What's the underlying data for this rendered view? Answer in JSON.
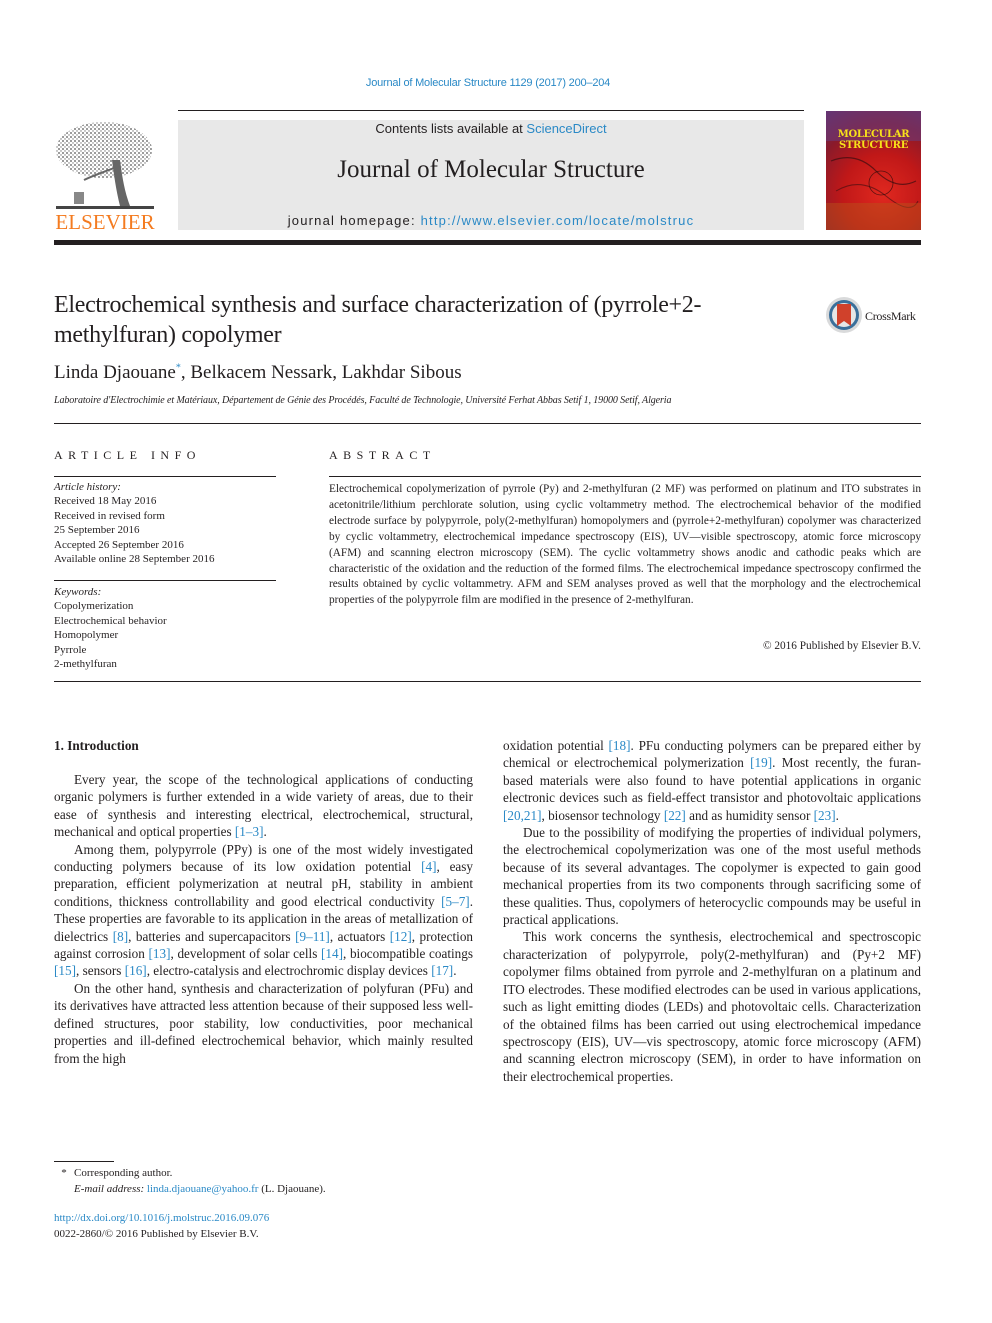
{
  "header": {
    "citation": "Journal of Molecular Structure 1129 (2017) 200–204",
    "contents_prefix": "Contents lists available at ",
    "contents_link": "ScienceDirect",
    "journal_name": "Journal of Molecular Structure",
    "homepage_prefix": "journal homepage: ",
    "homepage_url": "http://www.elsevier.com/locate/molstruc",
    "publisher_logo_text": "ELSEVIER",
    "cover_title_line1": "MOLECULAR",
    "cover_title_line2": "STRUCTURE",
    "colors": {
      "link": "#2a89c6",
      "elsevier_orange": "#f47b20",
      "grey_box": "#e8e8e8",
      "cover_yellow": "#f7e11a"
    }
  },
  "article": {
    "title": "Electrochemical synthesis and surface characterization of (pyrrole+2-methylfuran) copolymer",
    "crossmark_label": "CrossMark",
    "authors": [
      {
        "name": "Linda Djaouane",
        "mark": "*"
      },
      {
        "name": "Belkacem Nessark",
        "mark": ""
      },
      {
        "name": "Lakhdar Sibous",
        "mark": ""
      }
    ],
    "author_sep": ", ",
    "affiliation": "Laboratoire d'Electrochimie et Matériaux, Département de Génie des Procédés, Faculté de Technologie, Université Ferhat Abbas Setif 1, 19000 Setif, Algeria"
  },
  "article_info": {
    "heading": "ARTICLE INFO",
    "history_label": "Article history:",
    "history": [
      "Received 18 May 2016",
      "Received in revised form",
      "25 September 2016",
      "Accepted 26 September 2016",
      "Available online 28 September 2016"
    ],
    "keywords_label": "Keywords:",
    "keywords": [
      "Copolymerization",
      "Electrochemical behavior",
      "Homopolymer",
      "Pyrrole",
      "2-methylfuran"
    ]
  },
  "abstract": {
    "heading": "ABSTRACT",
    "text": "Electrochemical copolymerization of pyrrole (Py) and 2-methylfuran (2 MF) was performed on platinum and ITO substrates in acetonitrile/lithium perchlorate solution, using cyclic voltammetry method. The electrochemical behavior of the modified electrode surface by polypyrrole, poly(2-methylfuran) homopolymers and (pyrrole+2-methylfuran) copolymer was characterized by cyclic voltammetry, electrochemical impedance spectroscopy (EIS), UV—visible spectroscopy, atomic force microscopy (AFM) and scanning electron microscopy (SEM). The cyclic voltammetry shows anodic and cathodic peaks which are characteristic of the oxidation and the reduction of the formed films. The electrochemical impedance spectroscopy confirmed the results obtained by cyclic voltammetry. AFM and SEM analyses proved as well that the morphology and the electrochemical properties of the polypyrrole film are modified in the presence of 2-methylfuran.",
    "copyright": "© 2016 Published by Elsevier B.V."
  },
  "body": {
    "section_heading": "1.  Introduction",
    "left_paragraphs": [
      [
        {
          "t": "Every year, the scope of the technological applications of conducting organic polymers is further extended in a wide variety of areas, due to their ease of synthesis and interesting electrical, electrochemical, structural, mechanical and optical properties "
        },
        {
          "ref": "[1–3]"
        },
        {
          "t": "."
        }
      ],
      [
        {
          "t": "Among them, polypyrrole (PPy) is one of the most widely investigated conducting polymers because of its low oxidation potential "
        },
        {
          "ref": "[4]"
        },
        {
          "t": ", easy preparation, efficient polymerization at neutral pH, stability in ambient conditions, thickness controllability and good electrical conductivity "
        },
        {
          "ref": "[5–7]"
        },
        {
          "t": ". These properties are favorable to its application in the areas of metallization of dielectrics "
        },
        {
          "ref": "[8]"
        },
        {
          "t": ", batteries and supercapacitors "
        },
        {
          "ref": "[9–11]"
        },
        {
          "t": ", actuators "
        },
        {
          "ref": "[12]"
        },
        {
          "t": ", protection against corrosion "
        },
        {
          "ref": "[13]"
        },
        {
          "t": ", development of solar cells "
        },
        {
          "ref": "[14]"
        },
        {
          "t": ", biocompatible coatings "
        },
        {
          "ref": "[15]"
        },
        {
          "t": ", sensors "
        },
        {
          "ref": "[16]"
        },
        {
          "t": ", electro-catalysis and electrochromic display devices "
        },
        {
          "ref": "[17]"
        },
        {
          "t": "."
        }
      ],
      [
        {
          "t": "On the other hand, synthesis and characterization of polyfuran (PFu) and its derivatives have attracted less attention because of their supposed less well-defined structures, poor stability, low conductivities, poor mechanical properties and ill-defined electrochemical behavior, which mainly resulted from the high"
        }
      ]
    ],
    "right_paragraphs": [
      [
        {
          "t": "oxidation potential "
        },
        {
          "ref": "[18]"
        },
        {
          "t": ". PFu conducting polymers can be prepared either by chemical or electrochemical polymerization "
        },
        {
          "ref": "[19]"
        },
        {
          "t": ". Most recently, the furan-based materials were also found to have potential applications in organic electronic devices such as field-effect transistor and photovoltaic applications "
        },
        {
          "ref": "[20,21]"
        },
        {
          "t": ", biosensor technology "
        },
        {
          "ref": "[22]"
        },
        {
          "t": " and as humidity sensor "
        },
        {
          "ref": "[23]"
        },
        {
          "t": "."
        }
      ],
      [
        {
          "t": "Due to the possibility of modifying the properties of individual polymers, the electrochemical copolymerization was one of the most useful methods because of its several advantages. The copolymer is expected to gain good mechanical properties from its two components through sacrificing some of these qualities. Thus, copolymers of heterocyclic compounds may be useful in practical applications."
        }
      ],
      [
        {
          "t": "This work concerns the synthesis, electrochemical and spectroscopic characterization of polypyrrole, poly(2-methylfuran) and (Py+2 MF) copolymer films obtained from pyrrole and 2-methylfuran on a platinum and ITO electrodes. These modified electrodes can be used in various applications, such as light emitting diodes (LEDs) and photovoltaic cells. Characterization of the obtained films has been carried out using electrochemical impedance spectroscopy (EIS), UV—vis spectroscopy, atomic force microscopy (AFM) and scanning electron microscopy (SEM), in order to have information on their electrochemical properties."
        }
      ]
    ]
  },
  "footnotes": {
    "corresponding_mark": "*",
    "corresponding_text": "Corresponding author.",
    "email_label": "E-mail address:",
    "email": "linda.djaouane@yahoo.fr",
    "email_suffix": " (L. Djaouane).",
    "doi_url": "http://dx.doi.org/10.1016/j.molstruc.2016.09.076",
    "issn_copyright": "0022-2860/© 2016 Published by Elsevier B.V."
  }
}
